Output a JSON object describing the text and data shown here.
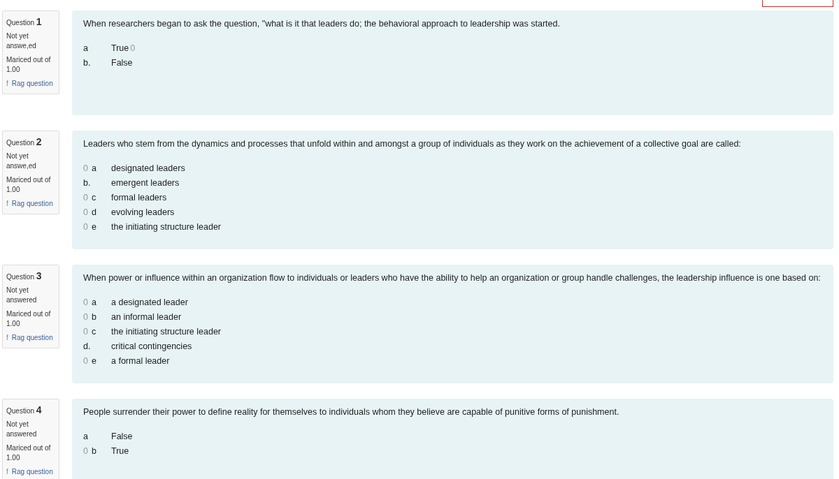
{
  "questions": [
    {
      "label": "Question",
      "number": "1",
      "status": [
        "Not yet",
        "answe,ed"
      ],
      "marked": "Mariced out of",
      "points": "1.00",
      "flag_prefix": "f",
      "flag": "Rag question",
      "text": "When researchers began to ask the question, \"what is it that leaders do; the behavioral approach to leadership was started.",
      "options": [
        {
          "kind": "trailing",
          "letter": "a",
          "text": "True",
          "marker": "0"
        },
        {
          "kind": "plain",
          "letter": "b.",
          "text": "False"
        }
      ]
    },
    {
      "label": "Question",
      "number": "2",
      "status": [
        "Not yet",
        "answe,ed"
      ],
      "marked": "Mariced out of",
      "points": "1.00",
      "flag_prefix": "f",
      "flag": "Rag question",
      "text": "Leaders who stem from the dynamics and processes that unfold within and amongst a group of individuals as they work on the achievement of a collective goal are called:",
      "options": [
        {
          "kind": "leading",
          "letter": "a",
          "text": "designated leaders",
          "marker": "0"
        },
        {
          "kind": "plain",
          "letter": "b.",
          "text": "emergent leaders"
        },
        {
          "kind": "leading",
          "letter": "c",
          "text": "formal leaders",
          "marker": "0"
        },
        {
          "kind": "leading",
          "letter": "d",
          "text": "evolving leaders",
          "marker": "0"
        },
        {
          "kind": "leading",
          "letter": "e",
          "text": "the initiating structure leader",
          "marker": "0"
        }
      ]
    },
    {
      "label": "Question",
      "number": "3",
      "status": [
        "Not yet",
        "answered"
      ],
      "marked": "Mariced out of",
      "points": "1.00",
      "flag_prefix": "f",
      "flag": "Rag question",
      "text": "When power or influence within an organization flow to individuals or leaders who have the ability to help an organization or group handle challenges, the leadership influence is one based on:",
      "options": [
        {
          "kind": "leading",
          "letter": "a",
          "text": "a designated leader",
          "marker": "0"
        },
        {
          "kind": "leading",
          "letter": "b",
          "text": "an informal leader",
          "marker": "0"
        },
        {
          "kind": "leading",
          "letter": "c",
          "text": "the initiating structure leader",
          "marker": "0"
        },
        {
          "kind": "plain",
          "letter": "d.",
          "text": "critical contingencies"
        },
        {
          "kind": "leading",
          "letter": "e",
          "text": "a formal leader",
          "marker": "0"
        }
      ]
    },
    {
      "label": "Question",
      "number": "4",
      "status": [
        "Not yet",
        "answered"
      ],
      "marked": "Mariced out of",
      "points": "1.00",
      "flag_prefix": "f",
      "flag": "Rag question",
      "text": "People surrender their power to define reality for themselves to individuals whom they believe are capable of punitive forms of punishment.",
      "options": [
        {
          "kind": "plain",
          "letter": "a",
          "text": "False"
        },
        {
          "kind": "leading",
          "letter": "b",
          "text": "True",
          "marker": "0"
        }
      ]
    }
  ]
}
